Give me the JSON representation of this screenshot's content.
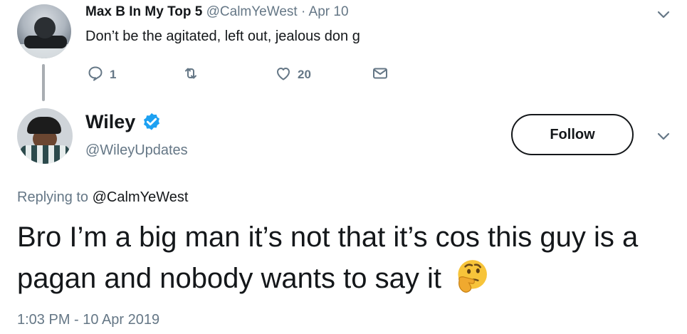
{
  "parent_tweet": {
    "display_name": "Max B In My Top 5",
    "handle": "@CalmYeWest",
    "separator": "·",
    "date": "Apr 10",
    "text": "Don’t be the agitated, left out,  jealous don g",
    "actions": {
      "reply_count": "1",
      "retweet_count": "",
      "like_count": "20"
    }
  },
  "main_tweet": {
    "display_name": "Wiley",
    "verified": true,
    "handle": "@WileyUpdates",
    "follow_label": "Follow",
    "replying_prefix": "Replying to",
    "replying_to": "@CalmYeWest",
    "text": "Bro I’m a big man it’s not that it’s cos this guy is a pagan and nobody wants to say it",
    "emoji": "thinking-face",
    "timestamp": "1:03 PM - 10 Apr 2019"
  },
  "colors": {
    "text_primary": "#14171a",
    "text_secondary": "#657786",
    "verified_blue": "#1da1f2",
    "thread_line": "#a8adb2"
  },
  "icons": {
    "reply": "reply-icon",
    "retweet": "retweet-icon",
    "like": "heart-icon",
    "dm": "envelope-icon",
    "caret": "chevron-down-icon",
    "verified": "verified-badge-icon"
  }
}
